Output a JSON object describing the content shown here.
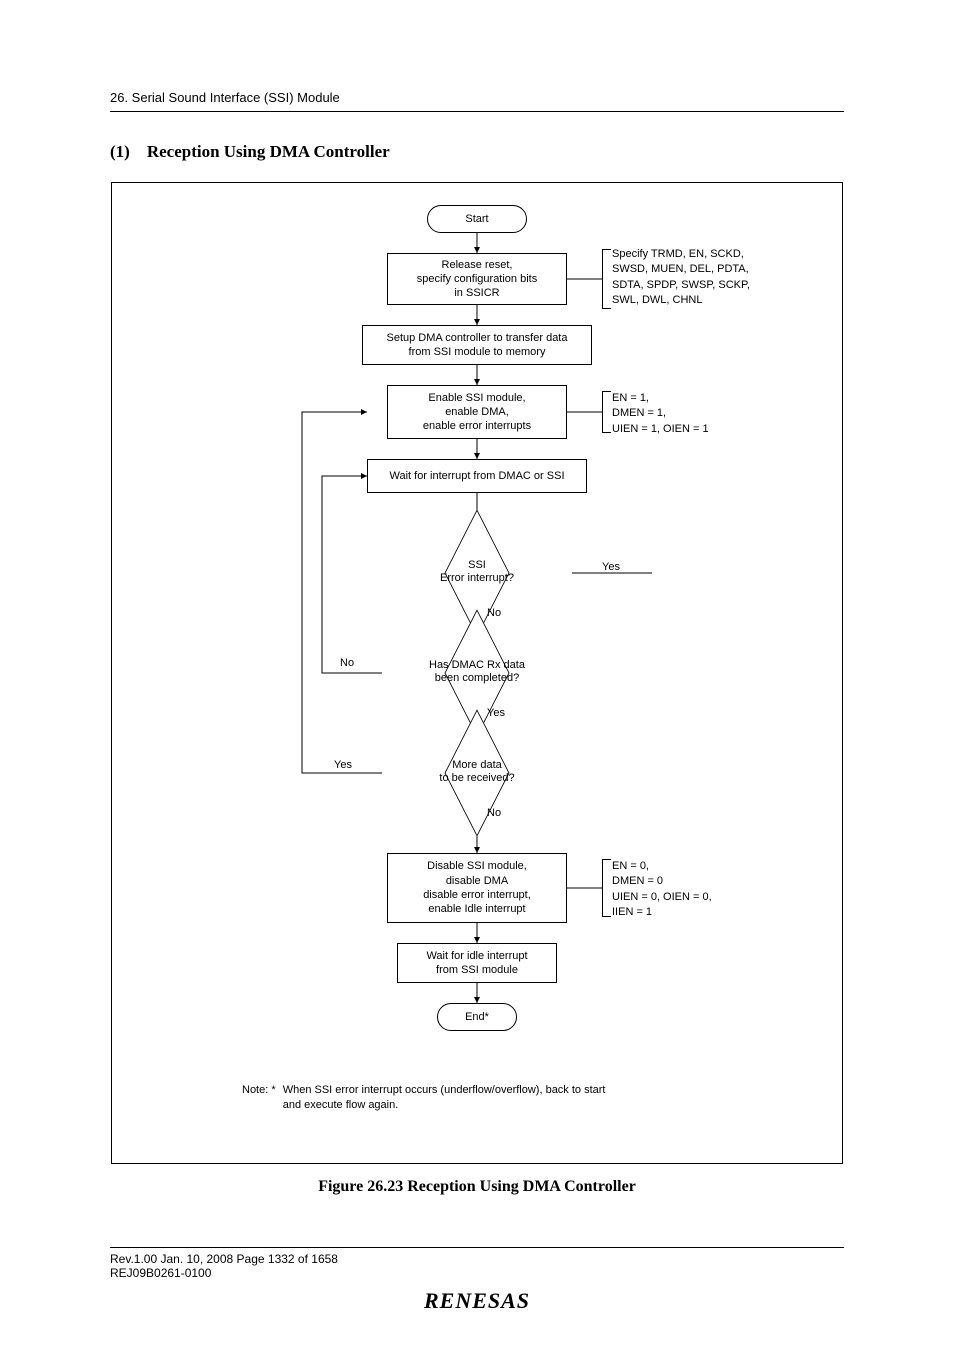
{
  "header": {
    "section": "26.   Serial Sound Interface (SSI) Module"
  },
  "heading": {
    "number": "(1)",
    "title": "Reception Using DMA Controller"
  },
  "flow": {
    "start": "Start",
    "release": "Release reset,\nspecify configuration bits\nin SSICR",
    "setup_dma": "Setup DMA controller to transfer data\nfrom SSI module to memory",
    "enable_ssi": "Enable SSI module,\nenable DMA,\nenable error interrupts",
    "wait_int": "Wait for interrupt from DMAC or SSI",
    "ssi_error": "SSI\nError interrupt?",
    "has_dmac": "Has DMAC Rx data\nbeen completed?",
    "more_data": "More data\nto be received?",
    "disable_ssi": "Disable SSI module,\ndisable DMA\ndisable error interrupt,\nenable Idle interrupt",
    "wait_idle": "Wait for idle interrupt\nfrom SSI module",
    "end": "End*",
    "note_label": "Note:   *",
    "note_text": "When SSI error interrupt occurs (underflow/overflow), back to start\nand execute flow again.",
    "annot1": "Specify TRMD, EN, SCKD,\nSWSD, MUEN, DEL, PDTA,\nSDTA, SPDP, SWSP, SCKP,\nSWL, DWL, CHNL",
    "annot2": "EN = 1,\nDMEN = 1,\nUIEN = 1, OIEN = 1",
    "annot3": "EN = 0,\nDMEN = 0\nUIEN = 0, OIEN = 0,\nIIEN = 1",
    "yes": "Yes",
    "no": "No"
  },
  "caption": "Figure 26.23   Reception Using DMA Controller",
  "footer": {
    "line1": "Rev.1.00  Jan. 10, 2008  Page 1332 of 1658",
    "line2": "REJ09B0261-0100",
    "brand": "RENESAS"
  },
  "chart_data": {
    "type": "flowchart",
    "title": "Reception Using DMA Controller",
    "nodes": [
      {
        "id": "start",
        "shape": "terminator",
        "text": "Start"
      },
      {
        "id": "release",
        "shape": "process",
        "text": "Release reset, specify configuration bits in SSICR",
        "annotation": "Specify TRMD, EN, SCKD, SWSD, MUEN, DEL, PDTA, SDTA, SPDP, SWSP, SCKP, SWL, DWL, CHNL"
      },
      {
        "id": "setup_dma",
        "shape": "process",
        "text": "Setup DMA controller to transfer data from SSI module to memory"
      },
      {
        "id": "enable_ssi",
        "shape": "process",
        "text": "Enable SSI module, enable DMA, enable error interrupts",
        "annotation": "EN = 1, DMEN = 1, UIEN = 1, OIEN = 1"
      },
      {
        "id": "wait_int",
        "shape": "process",
        "text": "Wait for interrupt from DMAC or SSI"
      },
      {
        "id": "ssi_error",
        "shape": "decision",
        "text": "SSI Error interrupt?"
      },
      {
        "id": "has_dmac",
        "shape": "decision",
        "text": "Has DMAC Rx data been completed?"
      },
      {
        "id": "more_data",
        "shape": "decision",
        "text": "More data to be received?"
      },
      {
        "id": "disable_ssi",
        "shape": "process",
        "text": "Disable SSI module, disable DMA, disable error interrupt, enable Idle interrupt",
        "annotation": "EN = 0, DMEN = 0, UIEN = 0, OIEN = 0, IIEN = 1"
      },
      {
        "id": "wait_idle",
        "shape": "process",
        "text": "Wait for idle interrupt from SSI module"
      },
      {
        "id": "end",
        "shape": "terminator",
        "text": "End*"
      }
    ],
    "edges": [
      {
        "from": "start",
        "to": "release"
      },
      {
        "from": "release",
        "to": "setup_dma"
      },
      {
        "from": "setup_dma",
        "to": "enable_ssi"
      },
      {
        "from": "enable_ssi",
        "to": "wait_int"
      },
      {
        "from": "wait_int",
        "to": "ssi_error"
      },
      {
        "from": "ssi_error",
        "to": "has_dmac",
        "label": "No"
      },
      {
        "from": "ssi_error",
        "to": "off_page_error",
        "label": "Yes"
      },
      {
        "from": "has_dmac",
        "to": "wait_int",
        "label": "No"
      },
      {
        "from": "has_dmac",
        "to": "more_data",
        "label": "Yes"
      },
      {
        "from": "more_data",
        "to": "enable_ssi",
        "label": "Yes"
      },
      {
        "from": "more_data",
        "to": "disable_ssi",
        "label": "No"
      },
      {
        "from": "disable_ssi",
        "to": "wait_idle"
      },
      {
        "from": "wait_idle",
        "to": "end"
      }
    ],
    "footnotes": [
      "* When SSI error interrupt occurs (underflow/overflow), back to start and execute flow again."
    ]
  }
}
